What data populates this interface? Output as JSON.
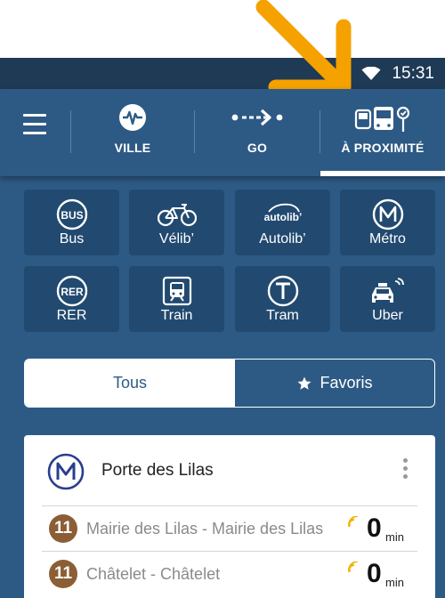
{
  "status_bar": {
    "time": "15:31"
  },
  "nav": {
    "tabs": [
      {
        "label": "VILLE",
        "icon": "pulse-icon"
      },
      {
        "label": "GO",
        "icon": "route-arrow-icon"
      },
      {
        "label": "À PROXIMITÉ",
        "icon": "transport-nearby-icon",
        "selected": true
      }
    ]
  },
  "modes": [
    {
      "label": "Bus",
      "icon": "bus-icon"
    },
    {
      "label": "Vélib’",
      "icon": "bike-icon"
    },
    {
      "label": "Autolib’",
      "icon": "autolib-icon",
      "logo_text": "autolib’"
    },
    {
      "label": "Métro",
      "icon": "metro-icon"
    },
    {
      "label": "RER",
      "icon": "rer-icon"
    },
    {
      "label": "Train",
      "icon": "train-icon"
    },
    {
      "label": "Tram",
      "icon": "tram-icon"
    },
    {
      "label": "Uber",
      "icon": "car-icon"
    }
  ],
  "filter": {
    "all_label": "Tous",
    "favorites_label": "Favoris",
    "selected": "Tous"
  },
  "station": {
    "name": "Porte des Lilas",
    "departures": [
      {
        "line": "11",
        "destination": "Mairie des Lilas - Mairie des Lilas",
        "minutes": "0",
        "unit": "min"
      },
      {
        "line": "11",
        "destination": "Châtelet - Châtelet",
        "minutes": "0",
        "unit": "min"
      }
    ]
  },
  "colors": {
    "primary": "#2d5a85",
    "tile": "#224a70",
    "status_bar": "#1e3a55",
    "line_11": "#8b5e35",
    "realtime": "#f0b400",
    "annotation_arrow": "#f5a100"
  }
}
